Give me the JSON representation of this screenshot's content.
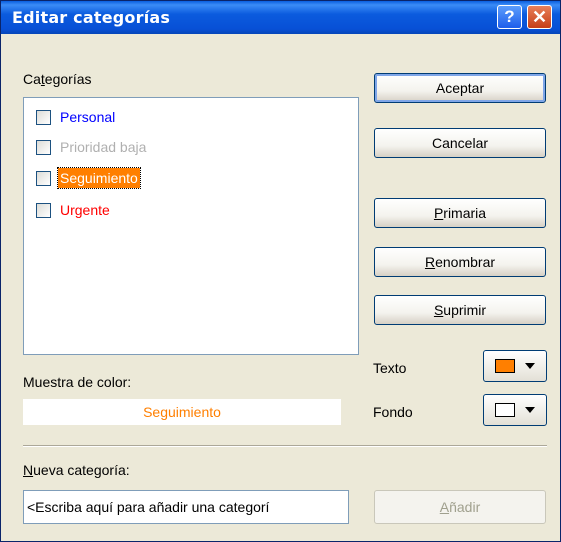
{
  "window": {
    "title": "Editar categorías",
    "help_glyph": "?",
    "close_glyph": "✕"
  },
  "categories": {
    "label_pre": "Ca",
    "label_accel": "t",
    "label_post": "egorías",
    "items": [
      {
        "label": "Personal",
        "checked": false,
        "color": "#0000FF",
        "selected": false
      },
      {
        "label": "Prioridad baja",
        "checked": false,
        "color": "#B0B0B0",
        "selected": false
      },
      {
        "label": "Seguimiento",
        "checked": false,
        "color": "#FF7F00",
        "selected": true
      },
      {
        "label": "Urgente",
        "checked": false,
        "color": "#FF0000",
        "selected": false
      }
    ]
  },
  "buttons": {
    "accept": "Aceptar",
    "cancel": "Cancelar",
    "primary_accel": "P",
    "primary_rest": "rimaria",
    "rename_accel": "R",
    "rename_rest": "enombrar",
    "delete_accel": "S",
    "delete_rest": "uprimir",
    "add_accel": "A",
    "add_rest": "ñadir"
  },
  "colors": {
    "text_label": "Texto",
    "text_color": "#FF7F00",
    "bg_label": "Fondo",
    "bg_color": "#FFFFFF"
  },
  "sample": {
    "label": "Muestra de color:",
    "text": "Seguimiento",
    "text_color": "#FF7F00"
  },
  "new_category": {
    "label_accel": "N",
    "label_rest": "ueva categoría:",
    "placeholder": "<Escriba aquí para añadir una categorí"
  }
}
